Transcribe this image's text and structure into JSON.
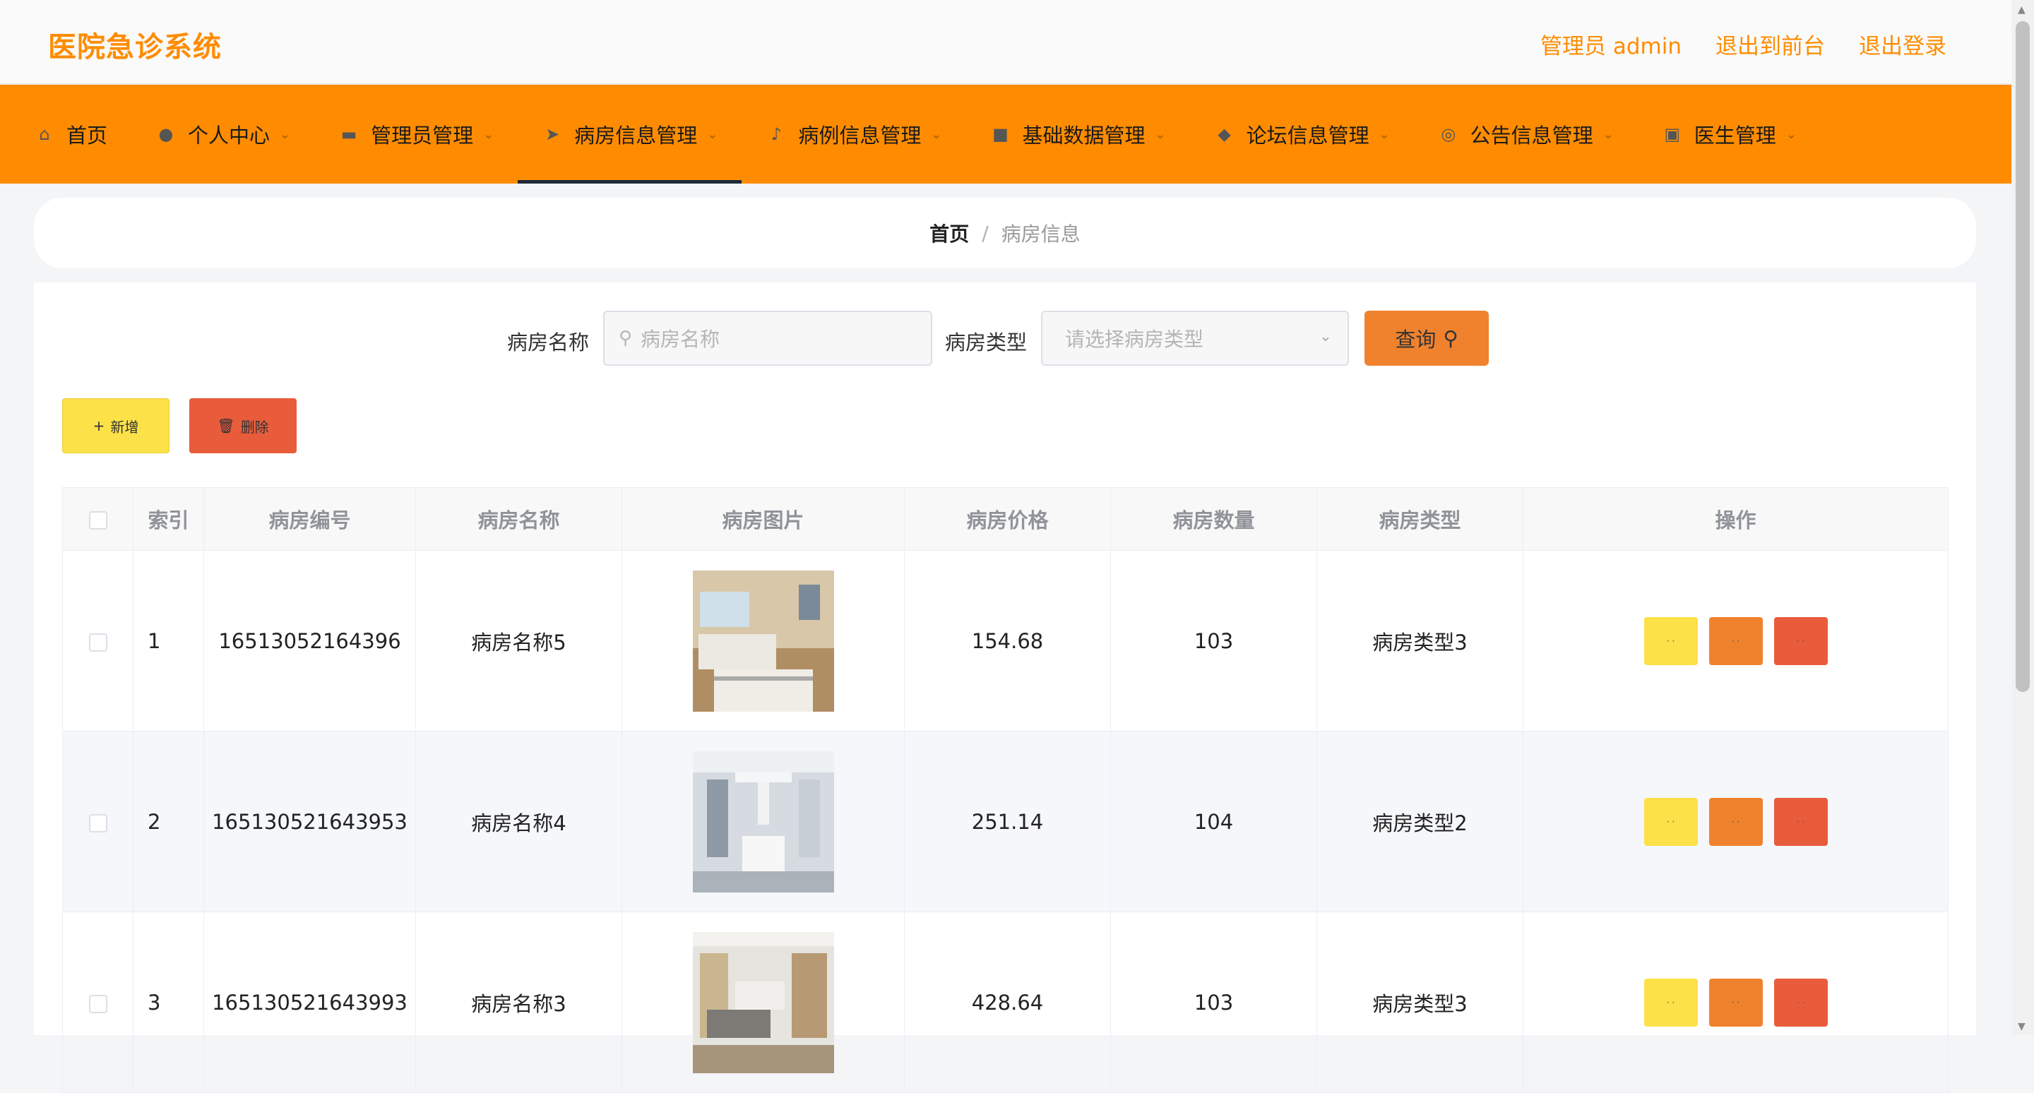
{
  "header": {
    "logo": "医院急诊系统",
    "admin_label": "管理员 admin",
    "back_front_label": "退出到前台",
    "logout_label": "退出登录"
  },
  "nav": {
    "items": [
      {
        "label": "首页",
        "icon": "home-icon"
      },
      {
        "label": "个人中心",
        "icon": "user-icon"
      },
      {
        "label": "管理员管理",
        "icon": "monitor-icon"
      },
      {
        "label": "病房信息管理",
        "icon": "send-icon"
      },
      {
        "label": "病例信息管理",
        "icon": "microphone-icon"
      },
      {
        "label": "基础数据管理",
        "icon": "briefcase-icon"
      },
      {
        "label": "论坛信息管理",
        "icon": "bell-icon"
      },
      {
        "label": "公告信息管理",
        "icon": "help-icon"
      },
      {
        "label": "医生管理",
        "icon": "picture-icon"
      }
    ],
    "active_index": 3
  },
  "breadcrumb": {
    "home": "首页",
    "separator": "/",
    "current": "病房信息"
  },
  "search": {
    "name_label": "病房名称",
    "name_placeholder": "病房名称",
    "type_label": "病房类型",
    "type_placeholder": "请选择病房类型",
    "query_label": "查询"
  },
  "actions": {
    "add_label": "新增",
    "delete_label": "删除"
  },
  "table": {
    "headers": [
      "索引",
      "病房编号",
      "病房名称",
      "病房图片",
      "病房价格",
      "病房数量",
      "病房类型",
      "操作"
    ],
    "rows": [
      {
        "index": "1",
        "code": "16513052164396",
        "name": "病房名称5",
        "price": "154.68",
        "count": "103",
        "type": "病房类型3"
      },
      {
        "index": "2",
        "code": "165130521643953",
        "name": "病房名称4",
        "price": "251.14",
        "count": "104",
        "type": "病房类型2"
      },
      {
        "index": "3",
        "code": "165130521643993",
        "name": "病房名称3",
        "price": "428.64",
        "count": "103",
        "type": "病房类型3"
      }
    ]
  },
  "colors": {
    "brand": "#ff8c00",
    "query": "#f0822e",
    "add": "#fce148",
    "delete": "#e85c3c"
  }
}
